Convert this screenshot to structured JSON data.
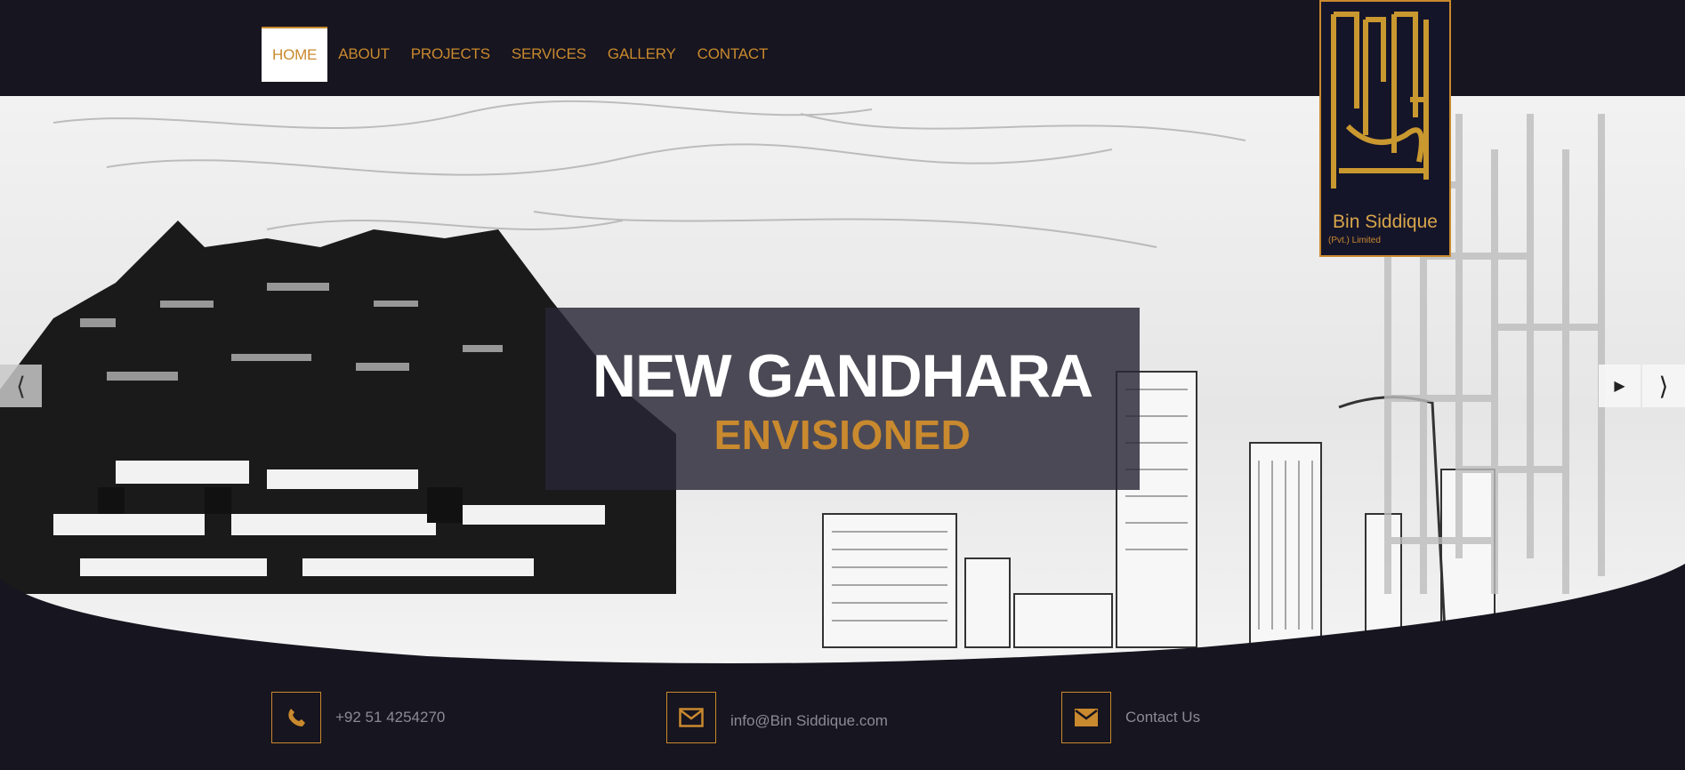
{
  "nav": {
    "items": [
      {
        "label": "HOME",
        "active": true
      },
      {
        "label": "ABOUT"
      },
      {
        "label": "PROJECTS"
      },
      {
        "label": "SERVICES"
      },
      {
        "label": "GALLERY"
      },
      {
        "label": "CONTACT"
      }
    ]
  },
  "logo": {
    "name": "Bin Siddique",
    "sub": "(Pvt.) Limited"
  },
  "hero": {
    "title": "NEW GANDHARA",
    "subtitle": "ENVISIONED",
    "prev_icon": "chevron-left-icon",
    "play_icon": "play-icon",
    "next_icon": "chevron-right-icon"
  },
  "contact": {
    "phone": "+92 51 4254270",
    "email": "info@Bin Siddique.com",
    "contact_label": "Contact Us"
  },
  "colors": {
    "background": "#17151f",
    "accent": "#c9892e",
    "caption_bg": "#282634",
    "text_muted": "#8b8b95"
  }
}
